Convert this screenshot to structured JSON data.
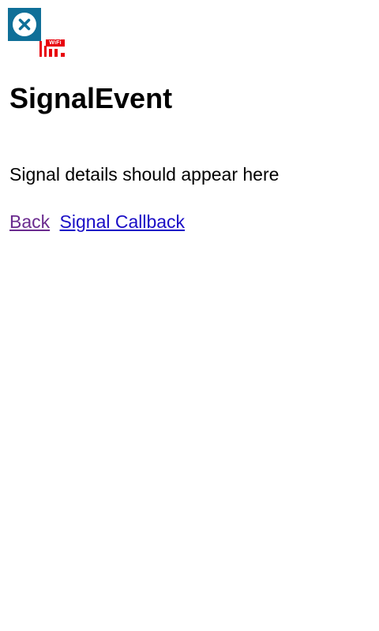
{
  "header": {
    "close_icon": "close-icon",
    "wifi_label": "WiFi",
    "wifi_icon": "signal-bars-icon",
    "colors": {
      "close_bg": "#0f6f98",
      "wifi_red": "#e8000b"
    }
  },
  "page": {
    "title": "SignalEvent",
    "details": "Signal details should appear here"
  },
  "links": {
    "back_label": "Back",
    "callback_label": "Signal Callback",
    "colors": {
      "visited": "#6a2a8e",
      "unvisited": "#1a0dc6"
    }
  }
}
